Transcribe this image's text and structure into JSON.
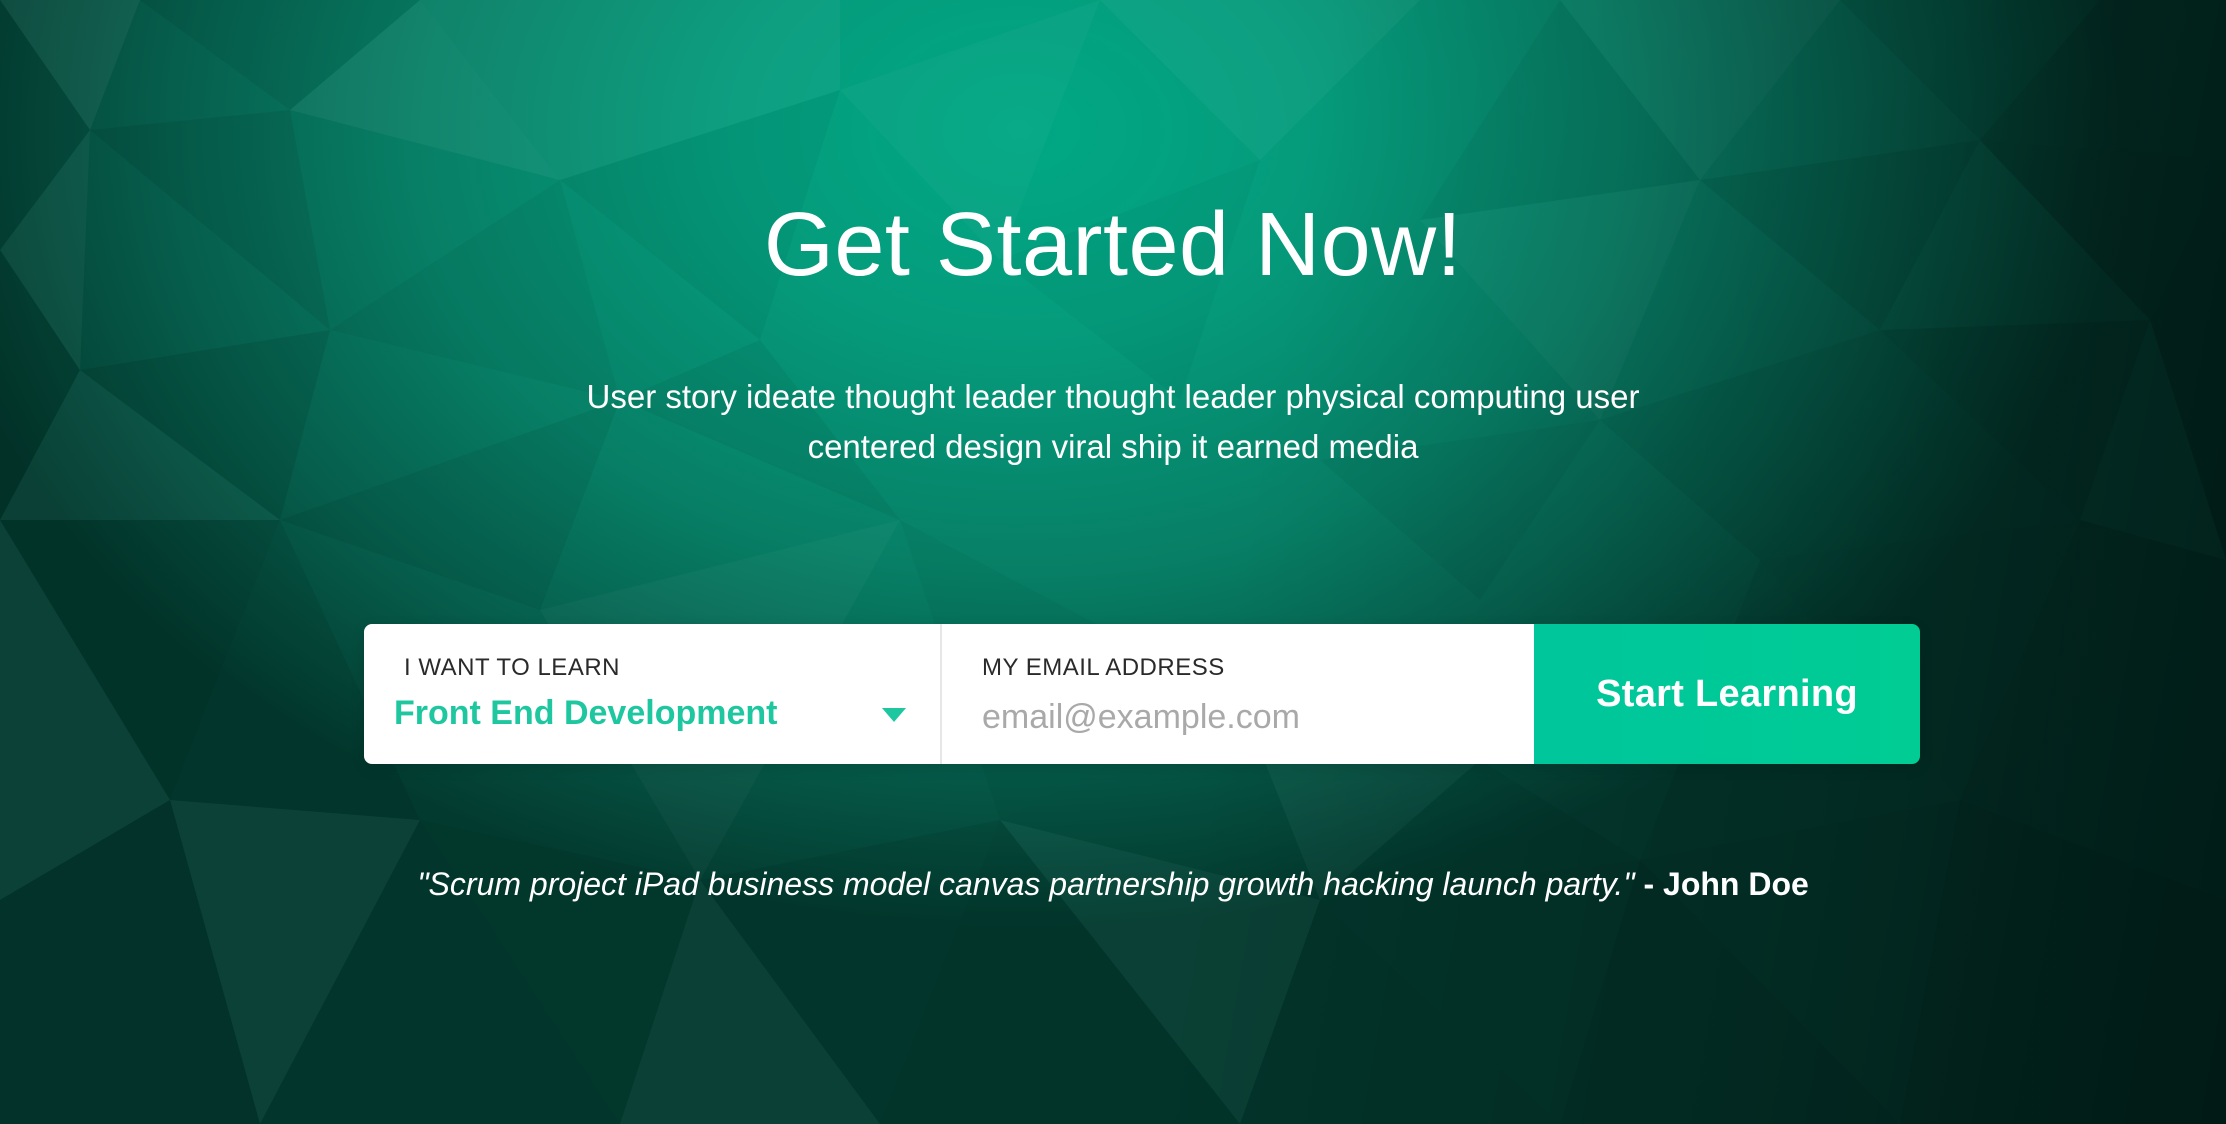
{
  "hero": {
    "title": "Get Started Now!",
    "subtitle": "User story ideate thought leader thought leader physical computing user centered design viral ship it earned media",
    "background_icon": "low-poly-pattern"
  },
  "signup_form": {
    "learn_label": "I WANT TO LEARN",
    "learn_selected": "Front End Development",
    "learn_caret_icon": "caret-down-icon",
    "email_label": "MY EMAIL ADDRESS",
    "email_value": "",
    "email_placeholder": "email@example.com",
    "submit_label": "Start Learning"
  },
  "testimonial": {
    "quote": "\"Scrum project iPad business model canvas partnership growth hacking launch party.\"",
    "separator": " - ",
    "author": "John Doe"
  },
  "colors": {
    "accent": "#1ec7a0",
    "button": "#00c69c",
    "background_light": "#00a884",
    "background_dark": "#033a2f"
  }
}
